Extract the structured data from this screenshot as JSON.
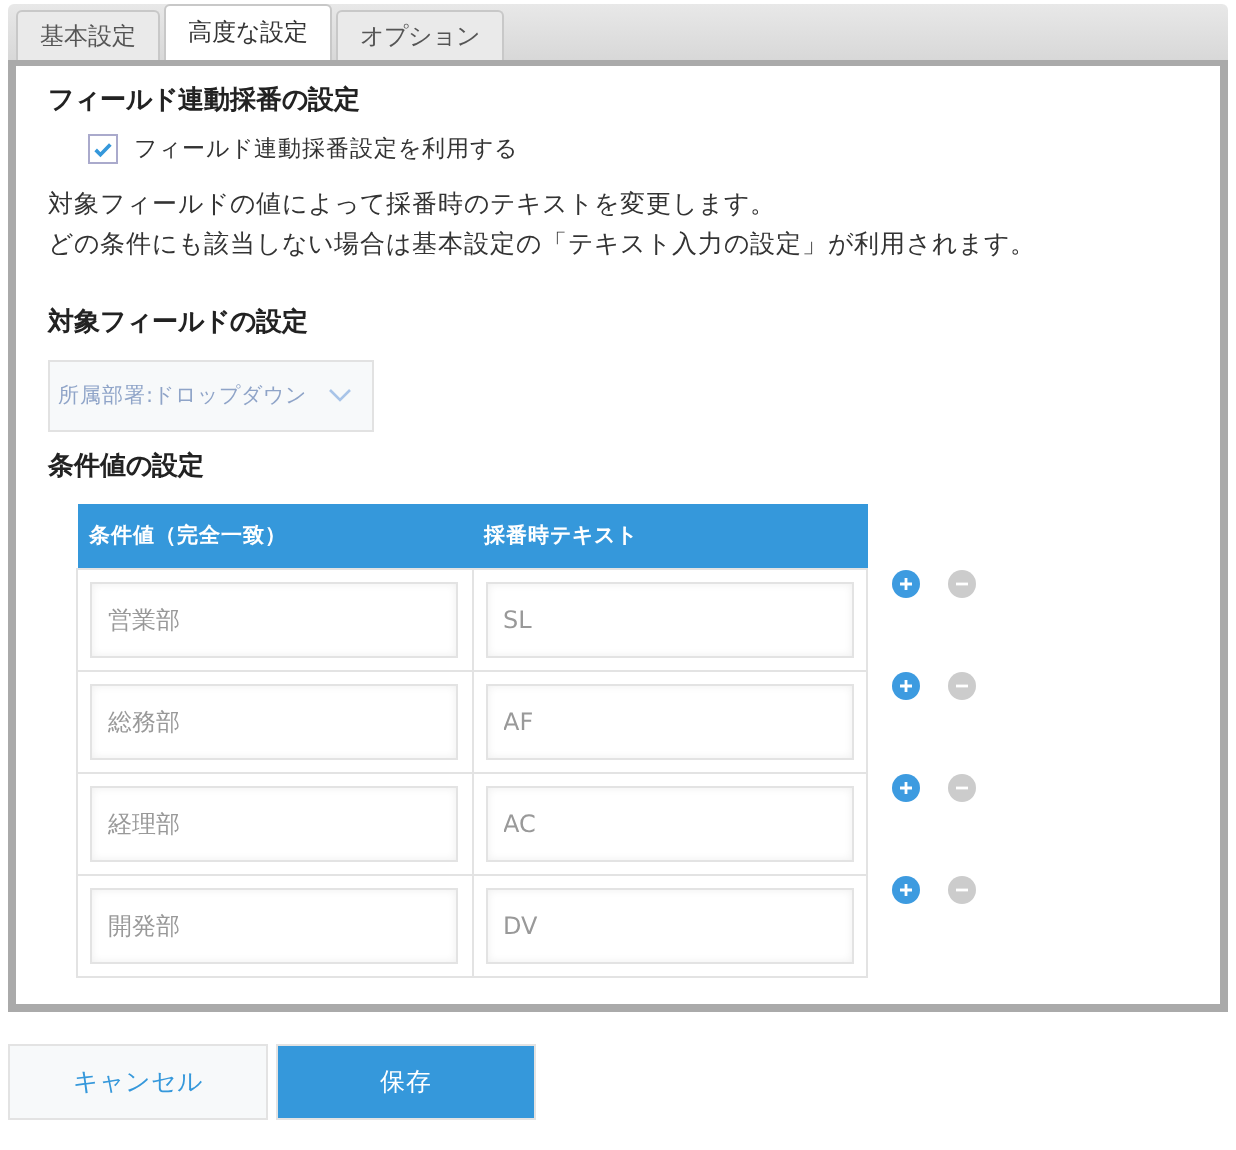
{
  "tabs": [
    {
      "label": "基本設定",
      "selected": false
    },
    {
      "label": "高度な設定",
      "selected": true
    },
    {
      "label": "オプション",
      "selected": false
    }
  ],
  "section_title": "フィールド連動採番の設定",
  "enable_checkbox": {
    "label": "フィールド連動採番設定を利用する",
    "checked": true
  },
  "description": [
    "対象フィールドの値によって採番時のテキストを変更します。",
    "どの条件にも該当しない場合は基本設定の「テキスト入力の設定」が利用されます。"
  ],
  "target_field": {
    "title": "対象フィールドの設定",
    "dropdown": "所属部署:ドロップダウン"
  },
  "conditions": {
    "title": "条件値の設定",
    "columns": [
      "条件値（完全一致）",
      "採番時テキスト"
    ],
    "rows": [
      {
        "condition": "営業部",
        "text": "SL"
      },
      {
        "condition": "総務部",
        "text": "AF"
      },
      {
        "condition": "経理部",
        "text": "AC"
      },
      {
        "condition": "開発部",
        "text": "DV"
      }
    ]
  },
  "buttons": {
    "cancel": "キャンセル",
    "save": "保存"
  }
}
